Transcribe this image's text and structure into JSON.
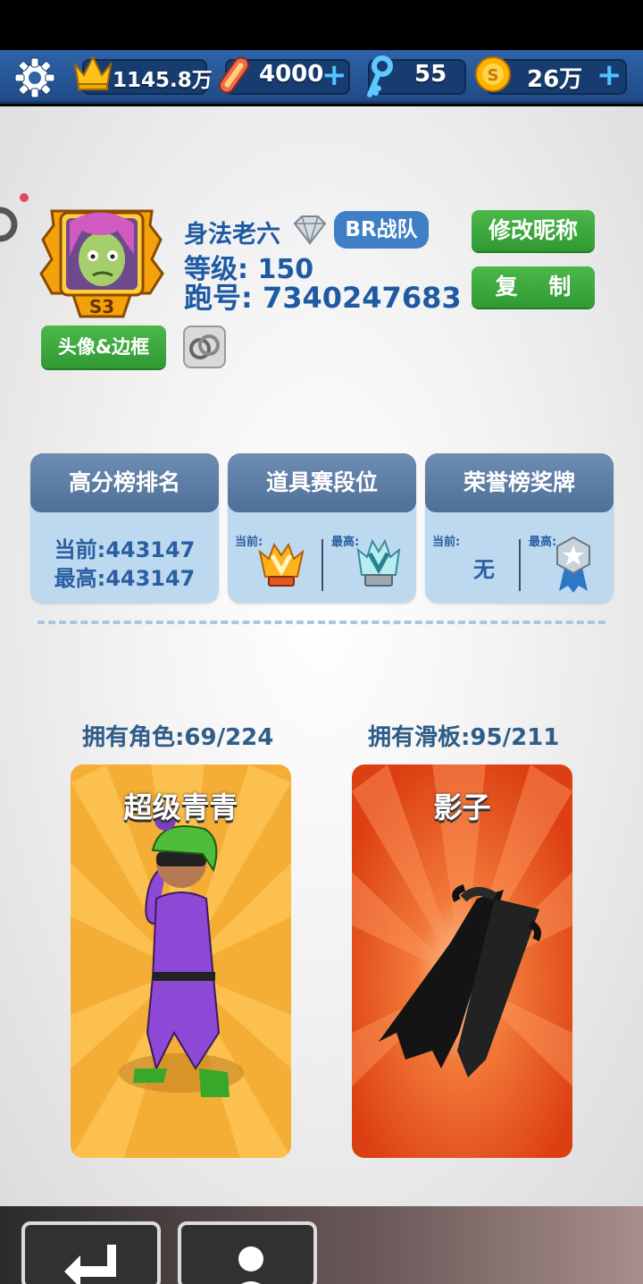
{
  "resources": {
    "crowns": "1145.8万",
    "hoverboards": "4000",
    "keys": "55",
    "coins": "26万",
    "plus": "+"
  },
  "profile": {
    "name": "身法老六",
    "team": "BR战队",
    "level_label": "等级:",
    "level": "150",
    "id_label": "跑号:",
    "id": "7340247683",
    "season_badge": "S3",
    "avatar_button": "头像&边框",
    "rename_button": "修改昵称",
    "copy_button": "复    制"
  },
  "stats": {
    "rank_card": {
      "title": "高分榜排名",
      "current": "当前:443147",
      "best": "最高:443147"
    },
    "item_card": {
      "title": "道具赛段位",
      "current_label": "当前:",
      "best_label": "最高:"
    },
    "honor_card": {
      "title": "荣誉榜奖牌",
      "current_label": "当前:",
      "current_value": "无",
      "best_label": "最高:"
    }
  },
  "collection": {
    "characters_owned": "拥有角色:69/224",
    "boards_owned": "拥有滑板:95/211",
    "character_name": "超级青青",
    "board_name": "影子"
  },
  "colors": {
    "accent_blue": "#1e5aa3",
    "button_green": "#3aa83d",
    "card_bg": "#bcd9ef",
    "character_bg": "#f5b13a",
    "board_bg": "#e0471b"
  }
}
